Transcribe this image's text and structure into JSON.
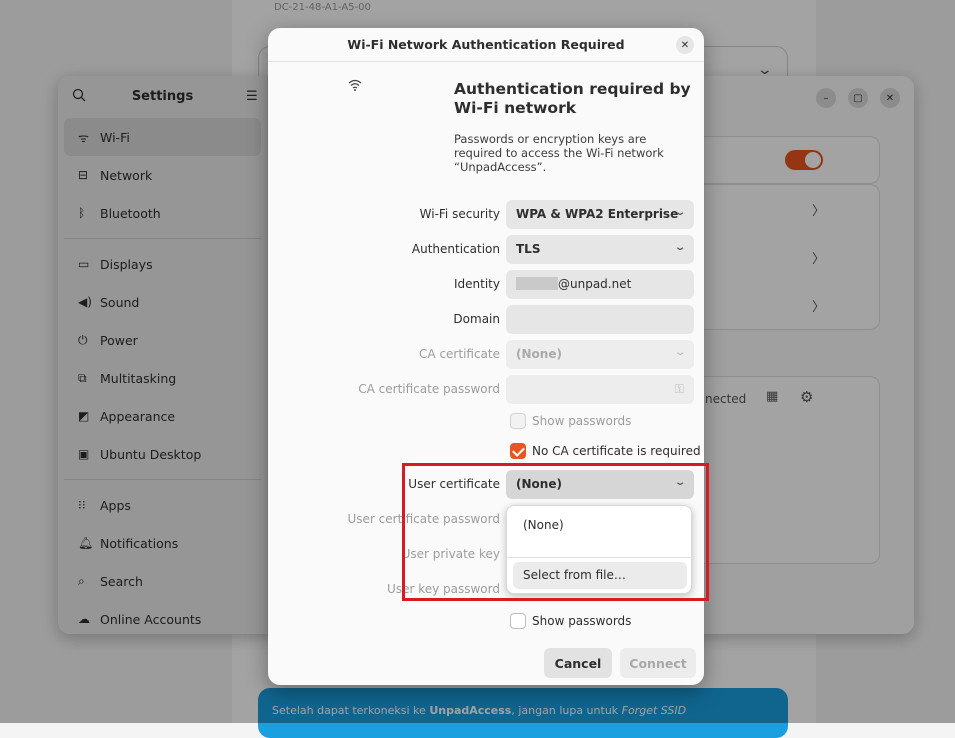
{
  "background_doc": {
    "top_text": "DC-21-48-A1-A5-00",
    "banner_pre": "Setelah dapat terkoneksi ke ",
    "banner_ssid": "UnpadAccess",
    "banner_mid": ", jangan lupa untuk ",
    "banner_forget": "Forget SSID"
  },
  "settings": {
    "title": "Settings",
    "sidebar": [
      {
        "label": "Wi-Fi",
        "icon": "wifi-icon"
      },
      {
        "label": "Network",
        "icon": "network-icon"
      },
      {
        "label": "Bluetooth",
        "icon": "bluetooth-icon"
      },
      {
        "label": "Displays",
        "icon": "display-icon"
      },
      {
        "label": "Sound",
        "icon": "sound-icon"
      },
      {
        "label": "Power",
        "icon": "power-icon"
      },
      {
        "label": "Multitasking",
        "icon": "multitasking-icon"
      },
      {
        "label": "Appearance",
        "icon": "appearance-icon"
      },
      {
        "label": "Ubuntu Desktop",
        "icon": "ubuntu-desktop-icon"
      },
      {
        "label": "Apps",
        "icon": "apps-icon"
      },
      {
        "label": "Notifications",
        "icon": "bell-icon"
      },
      {
        "label": "Search",
        "icon": "search-icon"
      },
      {
        "label": "Online Accounts",
        "icon": "cloud-icon"
      }
    ],
    "connected_fragment": "nected",
    "accent": "#e95420"
  },
  "dialog": {
    "title": "Wi-Fi Network Authentication Required",
    "heading": "Authentication required by Wi-Fi network",
    "description": "Passwords or encryption keys are required to access the Wi-Fi network “UnpadAccess”.",
    "fields": {
      "wifi_security": {
        "label": "Wi-Fi security",
        "value": "WPA & WPA2 Enterprise"
      },
      "authentication": {
        "label": "Authentication",
        "value": "TLS"
      },
      "identity": {
        "label": "Identity",
        "value": "@unpad.net"
      },
      "domain": {
        "label": "Domain",
        "value": ""
      },
      "ca_certificate": {
        "label": "CA certificate",
        "value": "(None)"
      },
      "ca_certificate_password": {
        "label": "CA certificate password",
        "value": ""
      },
      "show_passwords_1": {
        "label": "Show passwords",
        "checked": false
      },
      "no_ca_required": {
        "label": "No CA certificate is required",
        "checked": true
      },
      "user_certificate": {
        "label": "User certificate",
        "value": "(None)"
      },
      "user_certificate_password": {
        "label": "User certificate password"
      },
      "user_private_key": {
        "label": "User private key"
      },
      "user_key_password": {
        "label": "User key password"
      },
      "show_passwords_2": {
        "label": "Show passwords",
        "checked": false
      }
    },
    "dropdown_options": [
      "(None)",
      "Select from file…"
    ],
    "buttons": {
      "cancel": "Cancel",
      "connect": "Connect"
    },
    "highlight_color": "#d81b23"
  }
}
